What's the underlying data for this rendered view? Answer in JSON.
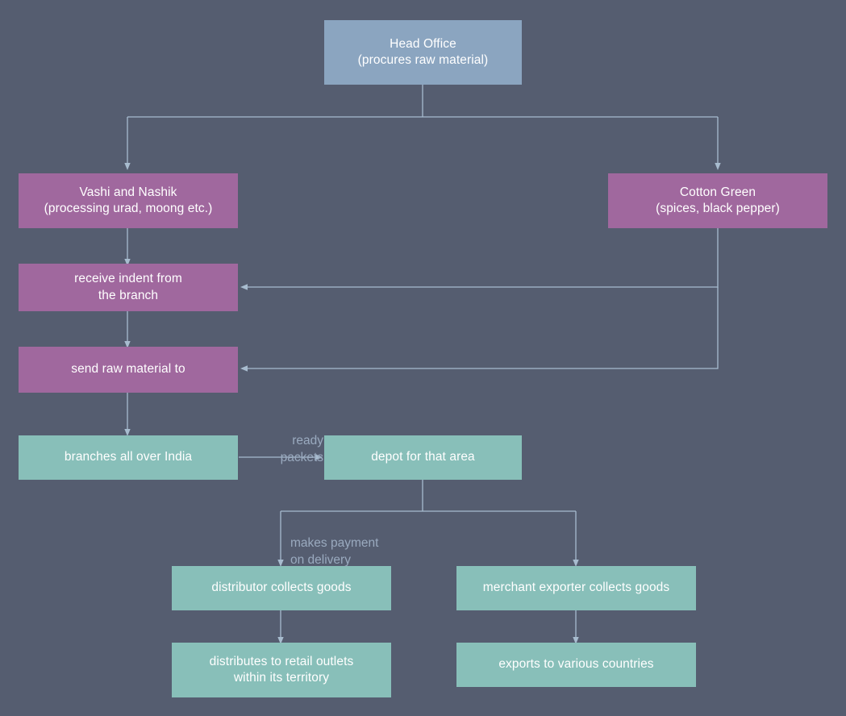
{
  "diagram": {
    "title": "Distribution flowchart",
    "background_color": "#555d70",
    "connector_color": "#a8bccf",
    "label_color": "#9aaabf",
    "nodes": [
      {
        "id": "head-office",
        "label": "Head Office\n(procures raw material)",
        "color": "#8ba5c0",
        "shape": "rect"
      },
      {
        "id": "vashi-nashik",
        "label": "Vashi and Nashik\n(processing urad, moong etc.)",
        "color": "#a0689e",
        "shape": "rect"
      },
      {
        "id": "cotton-green",
        "label": "Cotton Green\n(spices, black pepper)",
        "color": "#a0689e",
        "shape": "rect"
      },
      {
        "id": "receive-indent",
        "label": "receive indent from\nthe branch",
        "color": "#a0689e",
        "shape": "rect"
      },
      {
        "id": "send-raw-material",
        "label": "send raw material to",
        "color": "#a0689e",
        "shape": "rect"
      },
      {
        "id": "branches-india",
        "label": "branches all over India",
        "color": "#88bfb9",
        "shape": "rect"
      },
      {
        "id": "depot-area",
        "label": "depot for that area",
        "color": "#88bfb9",
        "shape": "rect"
      },
      {
        "id": "distributor-collects",
        "label": "distributor collects goods",
        "color": "#88bfb9",
        "shape": "rect"
      },
      {
        "id": "merchant-exporter-collects",
        "label": "merchant exporter collects goods",
        "color": "#88bfb9",
        "shape": "rect"
      },
      {
        "id": "distributes-retail",
        "label": "distributes to retail outlets\nwithin its territory",
        "color": "#88bfb9",
        "shape": "rect"
      },
      {
        "id": "exports-countries",
        "label": "exports to various countries",
        "color": "#88bfb9",
        "shape": "rect"
      }
    ],
    "edge_labels": [
      {
        "id": "ready-packets",
        "text": "ready\npackets"
      },
      {
        "id": "makes-payment",
        "text": "makes payment\non delivery"
      }
    ],
    "edges": [
      {
        "from": "head-office",
        "to": "vashi-nashik",
        "label": ""
      },
      {
        "from": "head-office",
        "to": "cotton-green",
        "label": ""
      },
      {
        "from": "vashi-nashik",
        "to": "receive-indent",
        "label": ""
      },
      {
        "from": "cotton-green",
        "to": "receive-indent",
        "label": ""
      },
      {
        "from": "cotton-green",
        "to": "send-raw-material",
        "label": ""
      },
      {
        "from": "receive-indent",
        "to": "send-raw-material",
        "label": ""
      },
      {
        "from": "send-raw-material",
        "to": "branches-india",
        "label": ""
      },
      {
        "from": "branches-india",
        "to": "depot-area",
        "label": "ready packets"
      },
      {
        "from": "depot-area",
        "to": "distributor-collects",
        "label": "makes payment on delivery"
      },
      {
        "from": "depot-area",
        "to": "merchant-exporter-collects",
        "label": ""
      },
      {
        "from": "distributor-collects",
        "to": "distributes-retail",
        "label": ""
      },
      {
        "from": "merchant-exporter-collects",
        "to": "exports-countries",
        "label": ""
      }
    ]
  }
}
